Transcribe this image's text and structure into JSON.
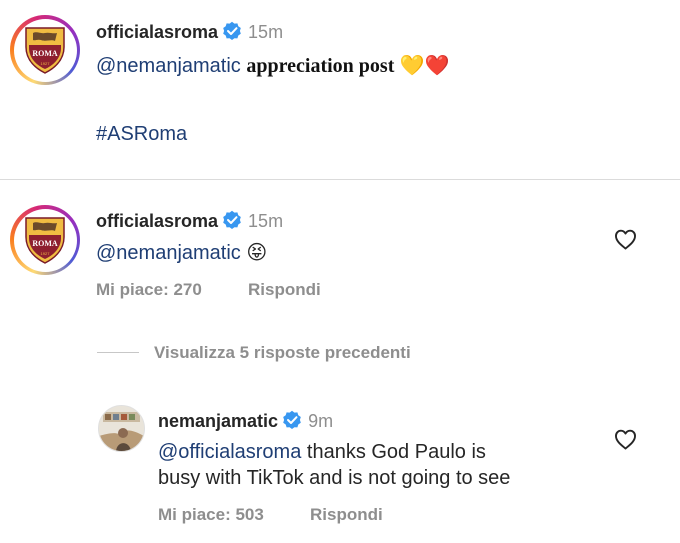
{
  "caption": {
    "username": "officialasroma",
    "time": "15m",
    "mention": "@nemanjamatic",
    "text": "appreciation post",
    "emojis": "💛❤️",
    "hashtag": "#ASRoma"
  },
  "comment1": {
    "username": "officialasroma",
    "time": "15m",
    "mention": "@nemanjamatic",
    "emoji": "😝",
    "likes_label": "Mi piace: 270",
    "reply_label": "Rispondi"
  },
  "view_replies_label": "Visualizza 5 risposte precedenti",
  "reply1": {
    "username": "nemanjamatic",
    "time": "9m",
    "mention": "@officialasroma",
    "text_line1": "thanks God Paulo is",
    "text_line2": "busy with TikTok and is not going to see",
    "likes_label": "Mi piace: 503",
    "reply_label": "Rispondi"
  },
  "colors": {
    "mention": "#1f3e74",
    "verified": "#3897f0",
    "muted": "#8e8e8e",
    "roma_red": "#8e1f2f",
    "roma_gold": "#f0bc42"
  },
  "logo_text": {
    "name": "ROMA",
    "year": "1927"
  }
}
